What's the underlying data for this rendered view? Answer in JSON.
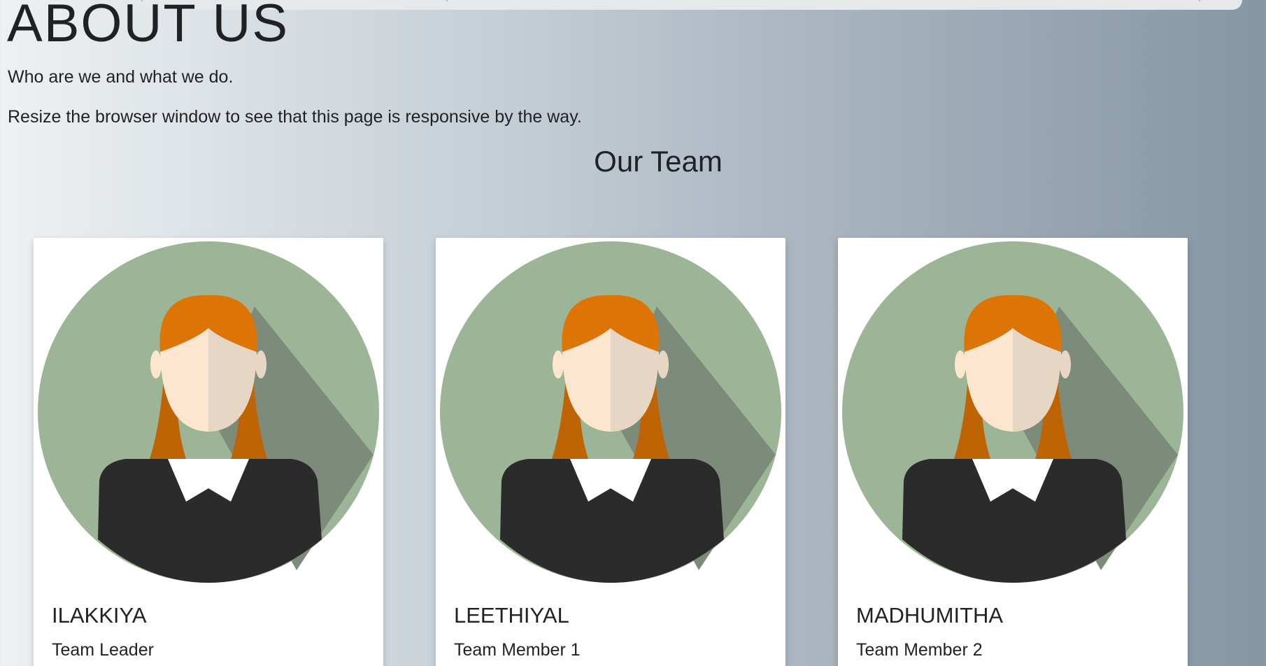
{
  "page": {
    "title": "ABOUT US",
    "subtitle": "Who are we and what we do.",
    "note": "Resize the browser window to see that this page is responsive by the way.",
    "team_heading": "Our Team"
  },
  "colors": {
    "avatar_bg": "#9db597",
    "avatar_shadow": "#7c8b7a",
    "hair": "#dd7406",
    "hair_dark": "#be6404",
    "skin": "#fde6d0",
    "skin_shade": "#e8d6c5",
    "jacket": "#2b2b2b",
    "collar": "#ffffff"
  },
  "team": [
    {
      "name": "ILAKKIYA",
      "role": "Team Leader",
      "avatar": "female-avatar-icon"
    },
    {
      "name": "LEETHIYAL",
      "role": "Team Member 1",
      "avatar": "female-avatar-icon"
    },
    {
      "name": "MADHUMITHA",
      "role": "Team Member 2",
      "avatar": "female-avatar-icon"
    }
  ]
}
